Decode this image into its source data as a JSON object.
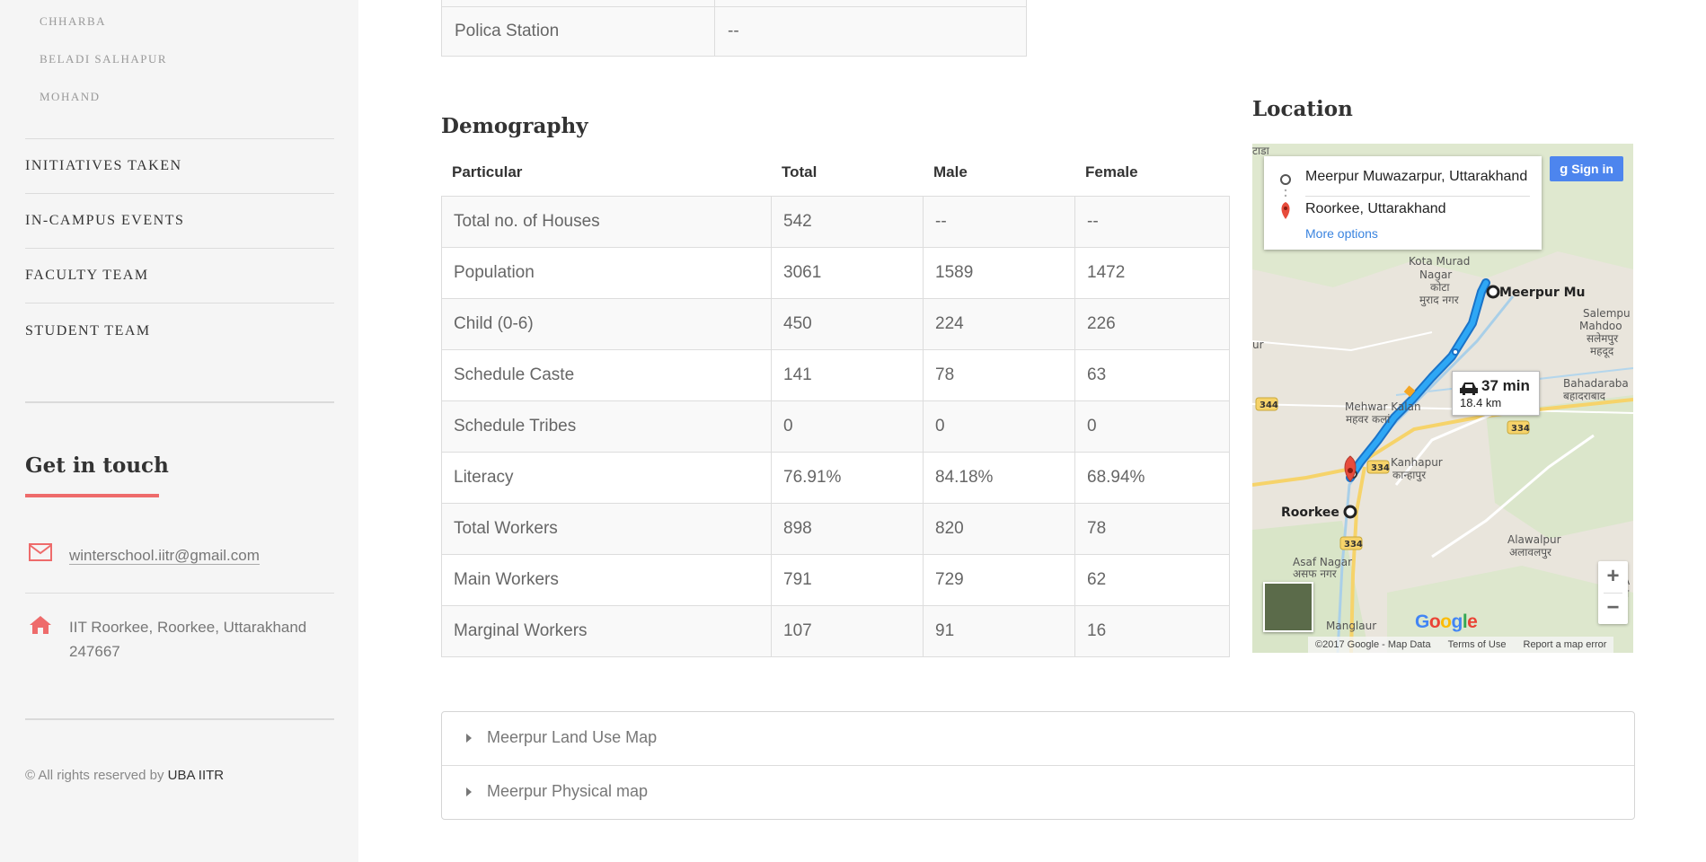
{
  "sidebar": {
    "sub_items": [
      "CHHARBA",
      "BELADI SALHAPUR",
      "MOHAND"
    ],
    "nav_items": [
      "INITIATIVES TAKEN",
      "IN-CAMPUS EVENTS",
      "FACULTY TEAM",
      "STUDENT TEAM"
    ],
    "get_in_touch": "Get in touch",
    "email": "winterschool.iitr@gmail.com",
    "address_line1": "IIT Roorkee, Roorkee, Uttarakhand",
    "address_line2": "247667",
    "copyright_prefix": "© All rights reserved by",
    "copyright_brand": "UBA IITR",
    "accent_color": "#ee6b6b"
  },
  "police": {
    "label": "Polica Station",
    "value": "--"
  },
  "demography": {
    "title": "Demography",
    "headers": [
      "Particular",
      "Total",
      "Male",
      "Female"
    ],
    "rows": [
      [
        "Total no. of Houses",
        "542",
        "--",
        "--"
      ],
      [
        "Population",
        "3061",
        "1589",
        "1472"
      ],
      [
        "Child (0-6)",
        "450",
        "224",
        "226"
      ],
      [
        "Schedule Caste",
        "141",
        "78",
        "63"
      ],
      [
        "Schedule Tribes",
        "0",
        "0",
        "0"
      ],
      [
        "Literacy",
        "76.91%",
        "84.18%",
        "68.94%"
      ],
      [
        "Total Workers",
        "898",
        "820",
        "78"
      ],
      [
        "Main Workers",
        "791",
        "729",
        "62"
      ],
      [
        "Marginal Workers",
        "107",
        "91",
        "16"
      ]
    ]
  },
  "location": {
    "title": "Location",
    "origin": "Meerpur Muwazarpur, Uttarakhand",
    "destination": "Roorkee, Uttarakhand",
    "more_options": "More options",
    "sign_in": "Sign in",
    "route_time": "37 min",
    "route_distance": "18.4 km",
    "zoom_in": "+",
    "zoom_out": "−",
    "footer_copyright": "©2017 Google - Map Data",
    "footer_terms": "Terms of Use",
    "footer_report": "Report a map error",
    "places": {
      "kota_murad": [
        "Kota Murad",
        "Nagar",
        "कोटा",
        "मुराद नगर"
      ],
      "meerpur": "Meerpur Mu",
      "salempur": [
        "Salempu",
        "Mahdoo",
        "सलेमपुर",
        "महदूद"
      ],
      "bahadarabad": [
        "Bahadaraba",
        "बहादराबाद"
      ],
      "mehwar": [
        "Mehwar Kalan",
        "महवर कलां"
      ],
      "kanhapur": [
        "Kanhapur",
        "कान्हापुर"
      ],
      "roorkee": "Roorkee",
      "alawalpur": [
        "Alawalpur",
        "अलावलपुर"
      ],
      "asaf": [
        "Asaf Nagar",
        "असफ नगर"
      ],
      "manglaur": "Manglaur",
      "top_fragment": "टाडा",
      "left_fragment": "ur",
      "right_fragment": [
        "A",
        "अ"
      ]
    },
    "roads": [
      "344",
      "334",
      "334",
      "334"
    ]
  },
  "accordion": {
    "items": [
      "Meerpur Land Use Map",
      "Meerpur Physical map"
    ]
  }
}
